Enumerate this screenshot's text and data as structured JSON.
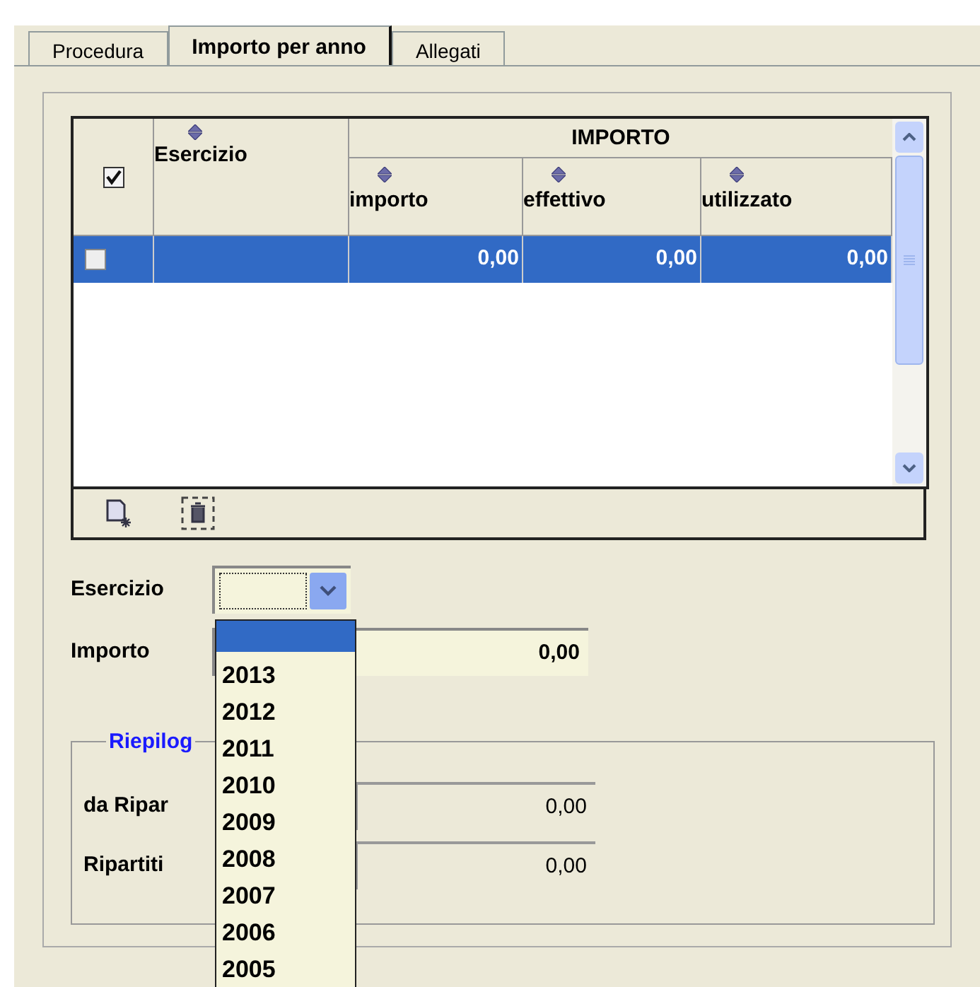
{
  "tabs": [
    {
      "label": "Procedura",
      "selected": false
    },
    {
      "label": "Importo per anno",
      "selected": true
    },
    {
      "label": "Allegati",
      "selected": false
    }
  ],
  "table": {
    "header_checked": true,
    "first_column": "Esercizio",
    "group_title": "IMPORTO",
    "columns": [
      "importo",
      "effettivo",
      "utilizzato"
    ],
    "rows": [
      {
        "checked": false,
        "selected": true,
        "values": [
          "0,00",
          "0,00",
          "0,00"
        ]
      }
    ]
  },
  "form": {
    "esercizio_label": "Esercizio",
    "importo_label": "Importo",
    "importo_value": "0,00"
  },
  "dropdown": {
    "items": [
      {
        "selected": true
      },
      {
        "label": "2013",
        "selected": false
      },
      {
        "label": "2012",
        "selected": false
      },
      {
        "label": "2011",
        "selected": false
      },
      {
        "label": "2010",
        "selected": false
      },
      {
        "label": "2009",
        "selected": false
      },
      {
        "label": "2008",
        "selected": false
      },
      {
        "label": "2007",
        "selected": false
      },
      {
        "label": "2006",
        "selected": false
      },
      {
        "label": "2005",
        "selected": false
      }
    ]
  },
  "summary": {
    "title": "Riepilog",
    "rows": [
      {
        "label": "da Ripar",
        "value": "0,00"
      },
      {
        "label": "Ripartiti",
        "value": "0,00"
      }
    ]
  }
}
